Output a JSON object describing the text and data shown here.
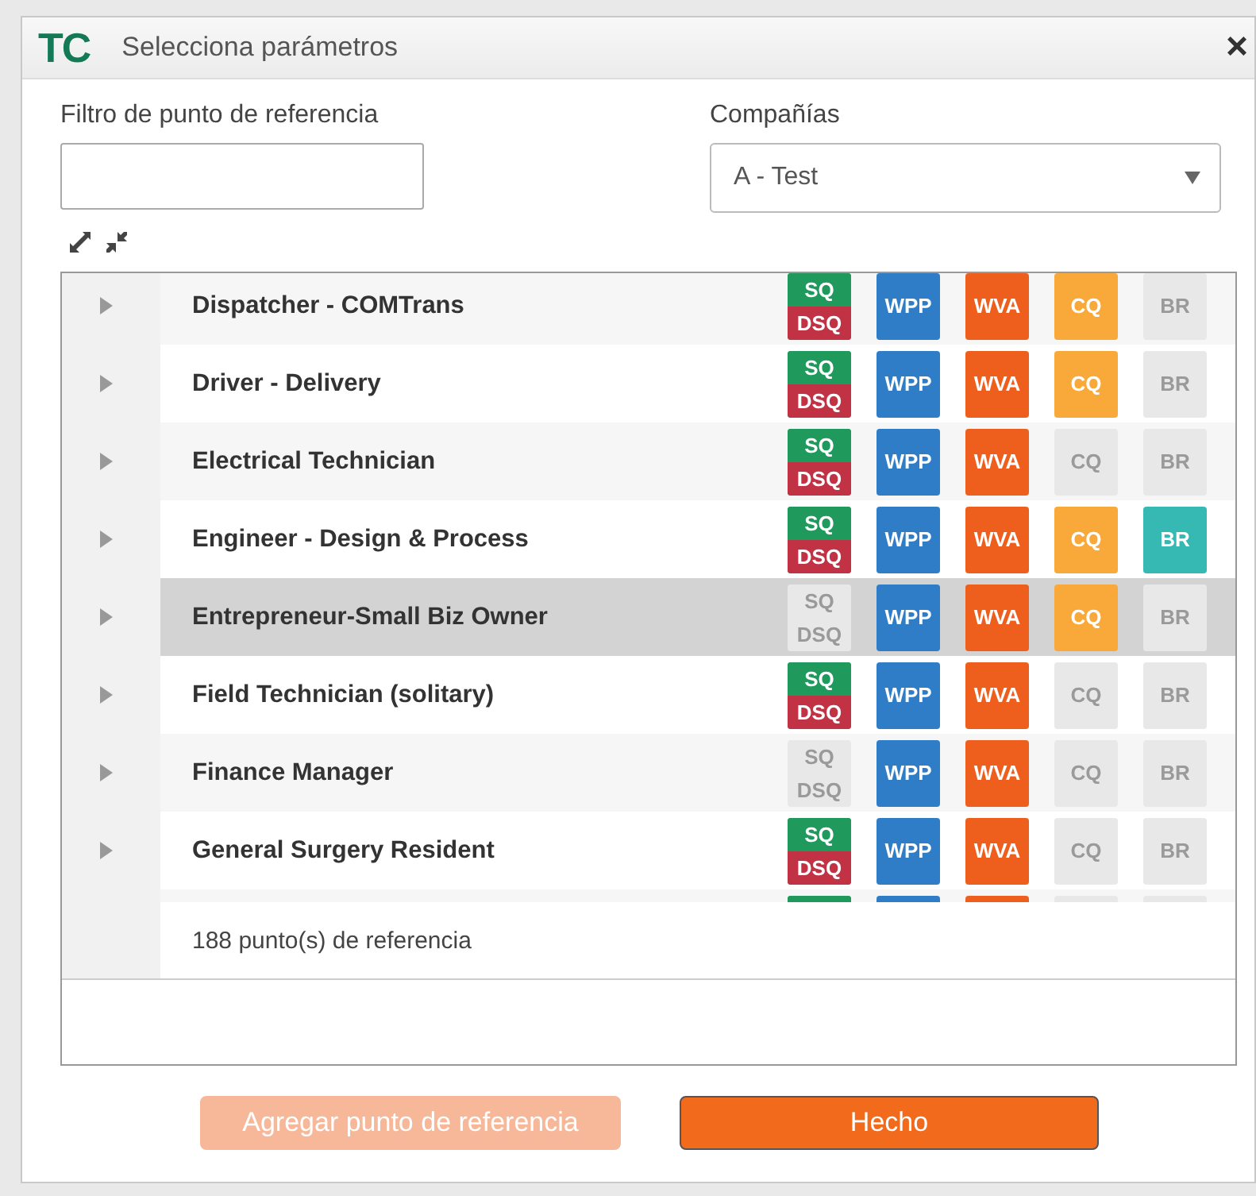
{
  "window": {
    "logo": "TC",
    "title": "Selecciona parámetros",
    "close": "×"
  },
  "filter": {
    "label": "Filtro de punto de referencia"
  },
  "companies": {
    "label": "Compañías",
    "value": "A - Test"
  },
  "rows": [
    {
      "name": "Dispatcher - COMTrans",
      "selected": false,
      "badges": [
        {
          "kind": "sq",
          "top": "SQ",
          "bottom": "DSQ",
          "active": true
        },
        {
          "kind": "wpp",
          "label": "WPP",
          "active": true
        },
        {
          "kind": "wva",
          "label": "WVA",
          "active": true
        },
        {
          "kind": "cq",
          "label": "CQ",
          "active": true
        },
        {
          "kind": "br",
          "label": "BR",
          "active": false
        }
      ]
    },
    {
      "name": "Driver - Delivery",
      "selected": false,
      "badges": [
        {
          "kind": "sq",
          "top": "SQ",
          "bottom": "DSQ",
          "active": true
        },
        {
          "kind": "wpp",
          "label": "WPP",
          "active": true
        },
        {
          "kind": "wva",
          "label": "WVA",
          "active": true
        },
        {
          "kind": "cq",
          "label": "CQ",
          "active": true
        },
        {
          "kind": "br",
          "label": "BR",
          "active": false
        }
      ]
    },
    {
      "name": "Electrical Technician",
      "selected": false,
      "badges": [
        {
          "kind": "sq",
          "top": "SQ",
          "bottom": "DSQ",
          "active": true
        },
        {
          "kind": "wpp",
          "label": "WPP",
          "active": true
        },
        {
          "kind": "wva",
          "label": "WVA",
          "active": true
        },
        {
          "kind": "cq",
          "label": "CQ",
          "active": false
        },
        {
          "kind": "br",
          "label": "BR",
          "active": false
        }
      ]
    },
    {
      "name": "Engineer - Design & Process",
      "selected": false,
      "badges": [
        {
          "kind": "sq",
          "top": "SQ",
          "bottom": "DSQ",
          "active": true
        },
        {
          "kind": "wpp",
          "label": "WPP",
          "active": true
        },
        {
          "kind": "wva",
          "label": "WVA",
          "active": true
        },
        {
          "kind": "cq",
          "label": "CQ",
          "active": true
        },
        {
          "kind": "br",
          "label": "BR",
          "active": true
        }
      ]
    },
    {
      "name": "Entrepreneur-Small Biz Owner",
      "selected": true,
      "badges": [
        {
          "kind": "sq",
          "top": "SQ",
          "bottom": "DSQ",
          "active": false
        },
        {
          "kind": "wpp",
          "label": "WPP",
          "active": true
        },
        {
          "kind": "wva",
          "label": "WVA",
          "active": true
        },
        {
          "kind": "cq",
          "label": "CQ",
          "active": true
        },
        {
          "kind": "br",
          "label": "BR",
          "active": false
        }
      ]
    },
    {
      "name": "Field Technician (solitary)",
      "selected": false,
      "badges": [
        {
          "kind": "sq",
          "top": "SQ",
          "bottom": "DSQ",
          "active": true
        },
        {
          "kind": "wpp",
          "label": "WPP",
          "active": true
        },
        {
          "kind": "wva",
          "label": "WVA",
          "active": true
        },
        {
          "kind": "cq",
          "label": "CQ",
          "active": false
        },
        {
          "kind": "br",
          "label": "BR",
          "active": false
        }
      ]
    },
    {
      "name": "Finance Manager",
      "selected": false,
      "badges": [
        {
          "kind": "sq",
          "top": "SQ",
          "bottom": "DSQ",
          "active": false
        },
        {
          "kind": "wpp",
          "label": "WPP",
          "active": true
        },
        {
          "kind": "wva",
          "label": "WVA",
          "active": true
        },
        {
          "kind": "cq",
          "label": "CQ",
          "active": false
        },
        {
          "kind": "br",
          "label": "BR",
          "active": false
        }
      ]
    },
    {
      "name": "General Surgery Resident",
      "selected": false,
      "badges": [
        {
          "kind": "sq",
          "top": "SQ",
          "bottom": "DSQ",
          "active": true
        },
        {
          "kind": "wpp",
          "label": "WPP",
          "active": true
        },
        {
          "kind": "wva",
          "label": "WVA",
          "active": true
        },
        {
          "kind": "cq",
          "label": "CQ",
          "active": false
        },
        {
          "kind": "br",
          "label": "BR",
          "active": false
        }
      ]
    },
    {
      "selected": false,
      "badges": [
        {
          "kind": "sq",
          "active": true
        },
        {
          "kind": "wpp",
          "active": true
        },
        {
          "kind": "wva",
          "active": true
        },
        {
          "kind": "cq",
          "active": false
        },
        {
          "kind": "br",
          "active": false
        }
      ]
    }
  ],
  "count": "188 punto(s) de referencia",
  "buttons": [
    {
      "label": "Agregar punto de referencia",
      "disabled": true
    },
    {
      "label": "Hecho",
      "disabled": false
    }
  ]
}
